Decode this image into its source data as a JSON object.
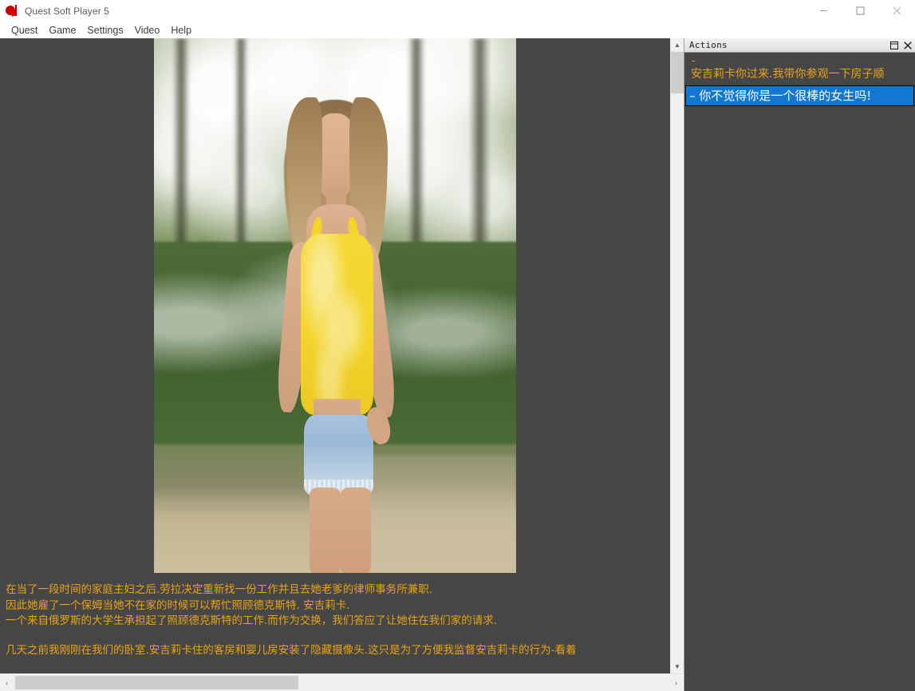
{
  "window": {
    "title": "Quest Soft Player 5",
    "icon": "quest-logo-icon",
    "controls": {
      "minimize": "—",
      "maximize": "□",
      "close": "✕"
    }
  },
  "menubar": {
    "items": [
      {
        "label": "Quest"
      },
      {
        "label": "Game"
      },
      {
        "label": "Settings"
      },
      {
        "label": "Video"
      },
      {
        "label": "Help"
      }
    ]
  },
  "main": {
    "image_alt": "game-illustration-young-woman-outdoors",
    "story_lines": [
      "在当了一段时间的家庭主妇之后.劳拉决定重新找一份工作并且去她老爹的律师事务所兼职.",
      "因此她雇了一个保姆当她不在家的时候可以帮忙照顾德克斯特. 安吉莉卡.",
      "一个来自俄罗斯的大学生承担起了照顾德克斯特的工作.而作为交换，我们答应了让她住在我们家的请求.",
      "",
      "几天之前我刚刚在我们的卧室.安吉莉卡住的客房和婴儿房安装了隐藏摄像头.这只是为了方便我监督安吉莉卡的行为-看着"
    ],
    "text_color": "#e8a317",
    "background_color": "#464646"
  },
  "scrollbars": {
    "vertical": {
      "up_arrow": "▲",
      "down_arrow": "▼"
    },
    "horizontal": {
      "left_arrow": "‹",
      "right_arrow": "›"
    }
  },
  "actions_panel": {
    "title": "Actions",
    "controls": {
      "restore": "❐",
      "close": "✕"
    },
    "dash_marker": "-",
    "items": [
      {
        "label": "安吉莉卡你过来.我带你参观一下房子顺",
        "selected": false,
        "color": "#e8a317"
      },
      {
        "label": "– 你不觉得你是一个很棒的女生吗!",
        "selected": true,
        "color": "#ffffff",
        "highlight_color": "#1177d1"
      }
    ]
  }
}
